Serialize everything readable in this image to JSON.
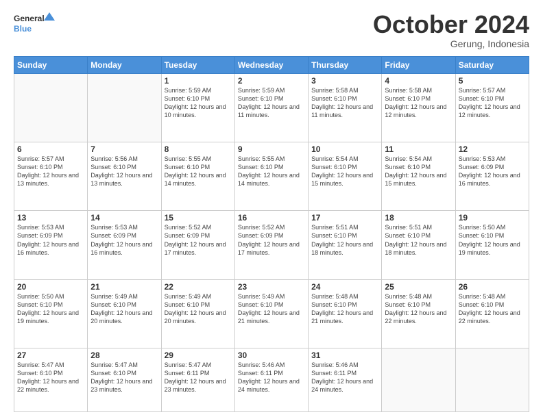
{
  "header": {
    "logo": {
      "line1": "General",
      "line2": "Blue"
    },
    "title": "October 2024",
    "location": "Gerung, Indonesia"
  },
  "weekdays": [
    "Sunday",
    "Monday",
    "Tuesday",
    "Wednesday",
    "Thursday",
    "Friday",
    "Saturday"
  ],
  "weeks": [
    [
      {
        "day": "",
        "info": ""
      },
      {
        "day": "",
        "info": ""
      },
      {
        "day": "1",
        "info": "Sunrise: 5:59 AM\nSunset: 6:10 PM\nDaylight: 12 hours\nand 10 minutes."
      },
      {
        "day": "2",
        "info": "Sunrise: 5:59 AM\nSunset: 6:10 PM\nDaylight: 12 hours\nand 11 minutes."
      },
      {
        "day": "3",
        "info": "Sunrise: 5:58 AM\nSunset: 6:10 PM\nDaylight: 12 hours\nand 11 minutes."
      },
      {
        "day": "4",
        "info": "Sunrise: 5:58 AM\nSunset: 6:10 PM\nDaylight: 12 hours\nand 12 minutes."
      },
      {
        "day": "5",
        "info": "Sunrise: 5:57 AM\nSunset: 6:10 PM\nDaylight: 12 hours\nand 12 minutes."
      }
    ],
    [
      {
        "day": "6",
        "info": "Sunrise: 5:57 AM\nSunset: 6:10 PM\nDaylight: 12 hours\nand 13 minutes."
      },
      {
        "day": "7",
        "info": "Sunrise: 5:56 AM\nSunset: 6:10 PM\nDaylight: 12 hours\nand 13 minutes."
      },
      {
        "day": "8",
        "info": "Sunrise: 5:55 AM\nSunset: 6:10 PM\nDaylight: 12 hours\nand 14 minutes."
      },
      {
        "day": "9",
        "info": "Sunrise: 5:55 AM\nSunset: 6:10 PM\nDaylight: 12 hours\nand 14 minutes."
      },
      {
        "day": "10",
        "info": "Sunrise: 5:54 AM\nSunset: 6:10 PM\nDaylight: 12 hours\nand 15 minutes."
      },
      {
        "day": "11",
        "info": "Sunrise: 5:54 AM\nSunset: 6:10 PM\nDaylight: 12 hours\nand 15 minutes."
      },
      {
        "day": "12",
        "info": "Sunrise: 5:53 AM\nSunset: 6:09 PM\nDaylight: 12 hours\nand 16 minutes."
      }
    ],
    [
      {
        "day": "13",
        "info": "Sunrise: 5:53 AM\nSunset: 6:09 PM\nDaylight: 12 hours\nand 16 minutes."
      },
      {
        "day": "14",
        "info": "Sunrise: 5:53 AM\nSunset: 6:09 PM\nDaylight: 12 hours\nand 16 minutes."
      },
      {
        "day": "15",
        "info": "Sunrise: 5:52 AM\nSunset: 6:09 PM\nDaylight: 12 hours\nand 17 minutes."
      },
      {
        "day": "16",
        "info": "Sunrise: 5:52 AM\nSunset: 6:09 PM\nDaylight: 12 hours\nand 17 minutes."
      },
      {
        "day": "17",
        "info": "Sunrise: 5:51 AM\nSunset: 6:10 PM\nDaylight: 12 hours\nand 18 minutes."
      },
      {
        "day": "18",
        "info": "Sunrise: 5:51 AM\nSunset: 6:10 PM\nDaylight: 12 hours\nand 18 minutes."
      },
      {
        "day": "19",
        "info": "Sunrise: 5:50 AM\nSunset: 6:10 PM\nDaylight: 12 hours\nand 19 minutes."
      }
    ],
    [
      {
        "day": "20",
        "info": "Sunrise: 5:50 AM\nSunset: 6:10 PM\nDaylight: 12 hours\nand 19 minutes."
      },
      {
        "day": "21",
        "info": "Sunrise: 5:49 AM\nSunset: 6:10 PM\nDaylight: 12 hours\nand 20 minutes."
      },
      {
        "day": "22",
        "info": "Sunrise: 5:49 AM\nSunset: 6:10 PM\nDaylight: 12 hours\nand 20 minutes."
      },
      {
        "day": "23",
        "info": "Sunrise: 5:49 AM\nSunset: 6:10 PM\nDaylight: 12 hours\nand 21 minutes."
      },
      {
        "day": "24",
        "info": "Sunrise: 5:48 AM\nSunset: 6:10 PM\nDaylight: 12 hours\nand 21 minutes."
      },
      {
        "day": "25",
        "info": "Sunrise: 5:48 AM\nSunset: 6:10 PM\nDaylight: 12 hours\nand 22 minutes."
      },
      {
        "day": "26",
        "info": "Sunrise: 5:48 AM\nSunset: 6:10 PM\nDaylight: 12 hours\nand 22 minutes."
      }
    ],
    [
      {
        "day": "27",
        "info": "Sunrise: 5:47 AM\nSunset: 6:10 PM\nDaylight: 12 hours\nand 22 minutes."
      },
      {
        "day": "28",
        "info": "Sunrise: 5:47 AM\nSunset: 6:10 PM\nDaylight: 12 hours\nand 23 minutes."
      },
      {
        "day": "29",
        "info": "Sunrise: 5:47 AM\nSunset: 6:11 PM\nDaylight: 12 hours\nand 23 minutes."
      },
      {
        "day": "30",
        "info": "Sunrise: 5:46 AM\nSunset: 6:11 PM\nDaylight: 12 hours\nand 24 minutes."
      },
      {
        "day": "31",
        "info": "Sunrise: 5:46 AM\nSunset: 6:11 PM\nDaylight: 12 hours\nand 24 minutes."
      },
      {
        "day": "",
        "info": ""
      },
      {
        "day": "",
        "info": ""
      }
    ]
  ]
}
